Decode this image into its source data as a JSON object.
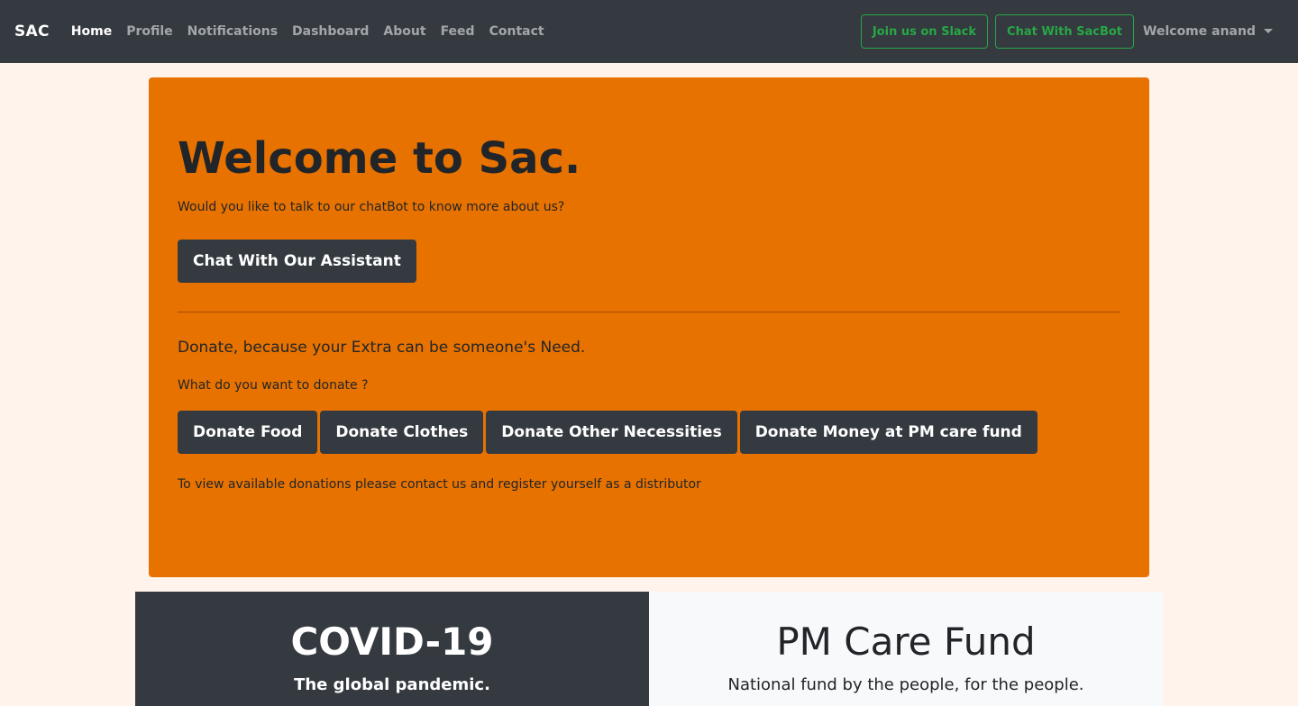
{
  "navbar": {
    "brand": "SAC",
    "links": [
      {
        "label": "Home",
        "active": true
      },
      {
        "label": "Profile",
        "active": false
      },
      {
        "label": "Notifications",
        "active": false
      },
      {
        "label": "Dashboard",
        "active": false
      },
      {
        "label": "About",
        "active": false
      },
      {
        "label": "Feed",
        "active": false
      },
      {
        "label": "Contact",
        "active": false
      }
    ],
    "slack_button": "Join us on Slack",
    "sacbot_button": "Chat With SacBot",
    "user_menu": "Welcome anand"
  },
  "jumbotron": {
    "title": "Welcome to Sac.",
    "lead": "Would you like to talk to our chatBot to know more about us?",
    "chat_button": "Chat With Our Assistant",
    "donate_heading": "Donate, because your Extra can be someone's Need.",
    "donate_question": "What do you want to donate ?",
    "donate_buttons": {
      "food": "Donate Food",
      "clothes": "Donate Clothes",
      "other": "Donate Other Necessities",
      "money": "Donate Money at PM care fund"
    },
    "distributor_note": "To view available donations please contact us and register yourself as a distributor"
  },
  "features": {
    "covid": {
      "title": "COVID-19",
      "subtitle": "The global pandemic."
    },
    "pmcare": {
      "title": "PM Care Fund",
      "subtitle": "National fund by the people, for the people."
    }
  },
  "colors": {
    "navbar_bg": "#343a40",
    "page_bg": "#fff3ec",
    "jumbotron_bg": "#e87200",
    "success_green": "#28a745",
    "dark_button": "#343a40"
  },
  "icons": {
    "user_menu_caret": "caret-down-icon"
  }
}
